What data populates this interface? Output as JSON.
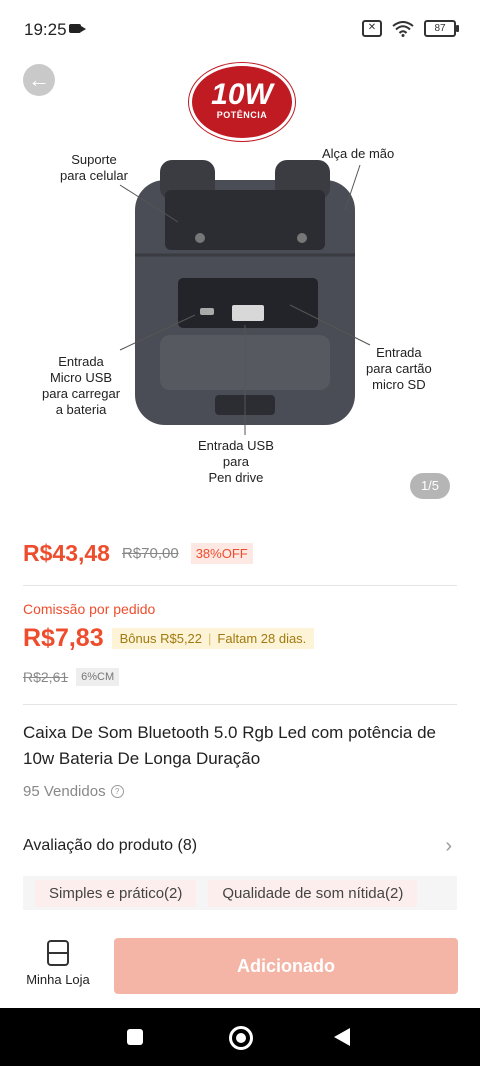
{
  "status_bar": {
    "time": "19:25",
    "battery": "87"
  },
  "gallery": {
    "badge_big": "10W",
    "badge_small": "POTÊNCIA",
    "label_phone_holder": "Suporte\npara celular",
    "label_handle": "Alça de mão",
    "label_micro_usb": "Entrada\nMicro USB\npara carregar\na bateria",
    "label_sd": "Entrada\npara cartão\nmicro SD",
    "label_usb": "Entrada USB\npara\nPen drive",
    "counter": "1/5"
  },
  "price": {
    "current": "R$43,48",
    "original": "R$70,00",
    "discount": "38%OFF"
  },
  "commission": {
    "title": "Comissão por pedido",
    "value": "R$7,83",
    "bonus": "Bônus R$5,22",
    "remaining": "Faltam 28 dias.",
    "old_value": "R$2,61",
    "rate": "6%CM"
  },
  "product": {
    "title": "Caixa De Som Bluetooth 5.0 Rgb Led com potência de 10w Bateria De Longa Duração",
    "sold": "95 Vendidos"
  },
  "reviews": {
    "title": "Avaliação do produto (8)",
    "chips": [
      "Simples e prático(2)",
      "Qualidade de som nítida(2)"
    ]
  },
  "bottom_bar": {
    "store_label": "Minha Loja",
    "add_button": "Adicionado"
  },
  "colors": {
    "accent": "#ee4d2d",
    "button_disabled": "#f5b5a6",
    "badge_red": "#c01a23"
  }
}
